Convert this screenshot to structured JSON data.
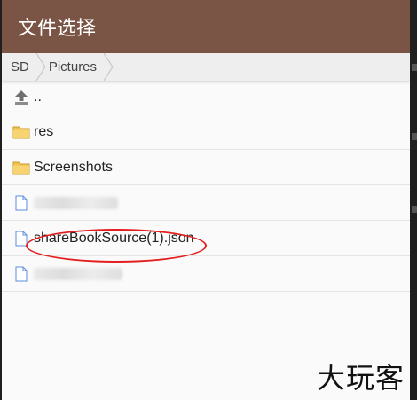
{
  "dialog": {
    "title": "文件选择"
  },
  "breadcrumb": {
    "items": [
      {
        "label": "SD"
      },
      {
        "label": "Pictures"
      }
    ]
  },
  "files": [
    {
      "type": "parent",
      "name": "..",
      "icon": "up-arrow-icon"
    },
    {
      "type": "folder",
      "name": "res",
      "icon": "folder-icon"
    },
    {
      "type": "folder",
      "name": "Screenshots",
      "icon": "folder-icon"
    },
    {
      "type": "file",
      "name": "",
      "icon": "file-icon",
      "redacted": true
    },
    {
      "type": "file",
      "name": "shareBookSource(1).json",
      "icon": "file-icon",
      "highlighted": true
    },
    {
      "type": "file",
      "name": "",
      "icon": "file-icon",
      "redacted": true
    }
  ],
  "watermark": {
    "text": "大玩客"
  },
  "colors": {
    "title_bar": "#7a5445",
    "highlight": "#e41e1e",
    "folder": "#f2c14e",
    "file": "#5a8ee0"
  }
}
